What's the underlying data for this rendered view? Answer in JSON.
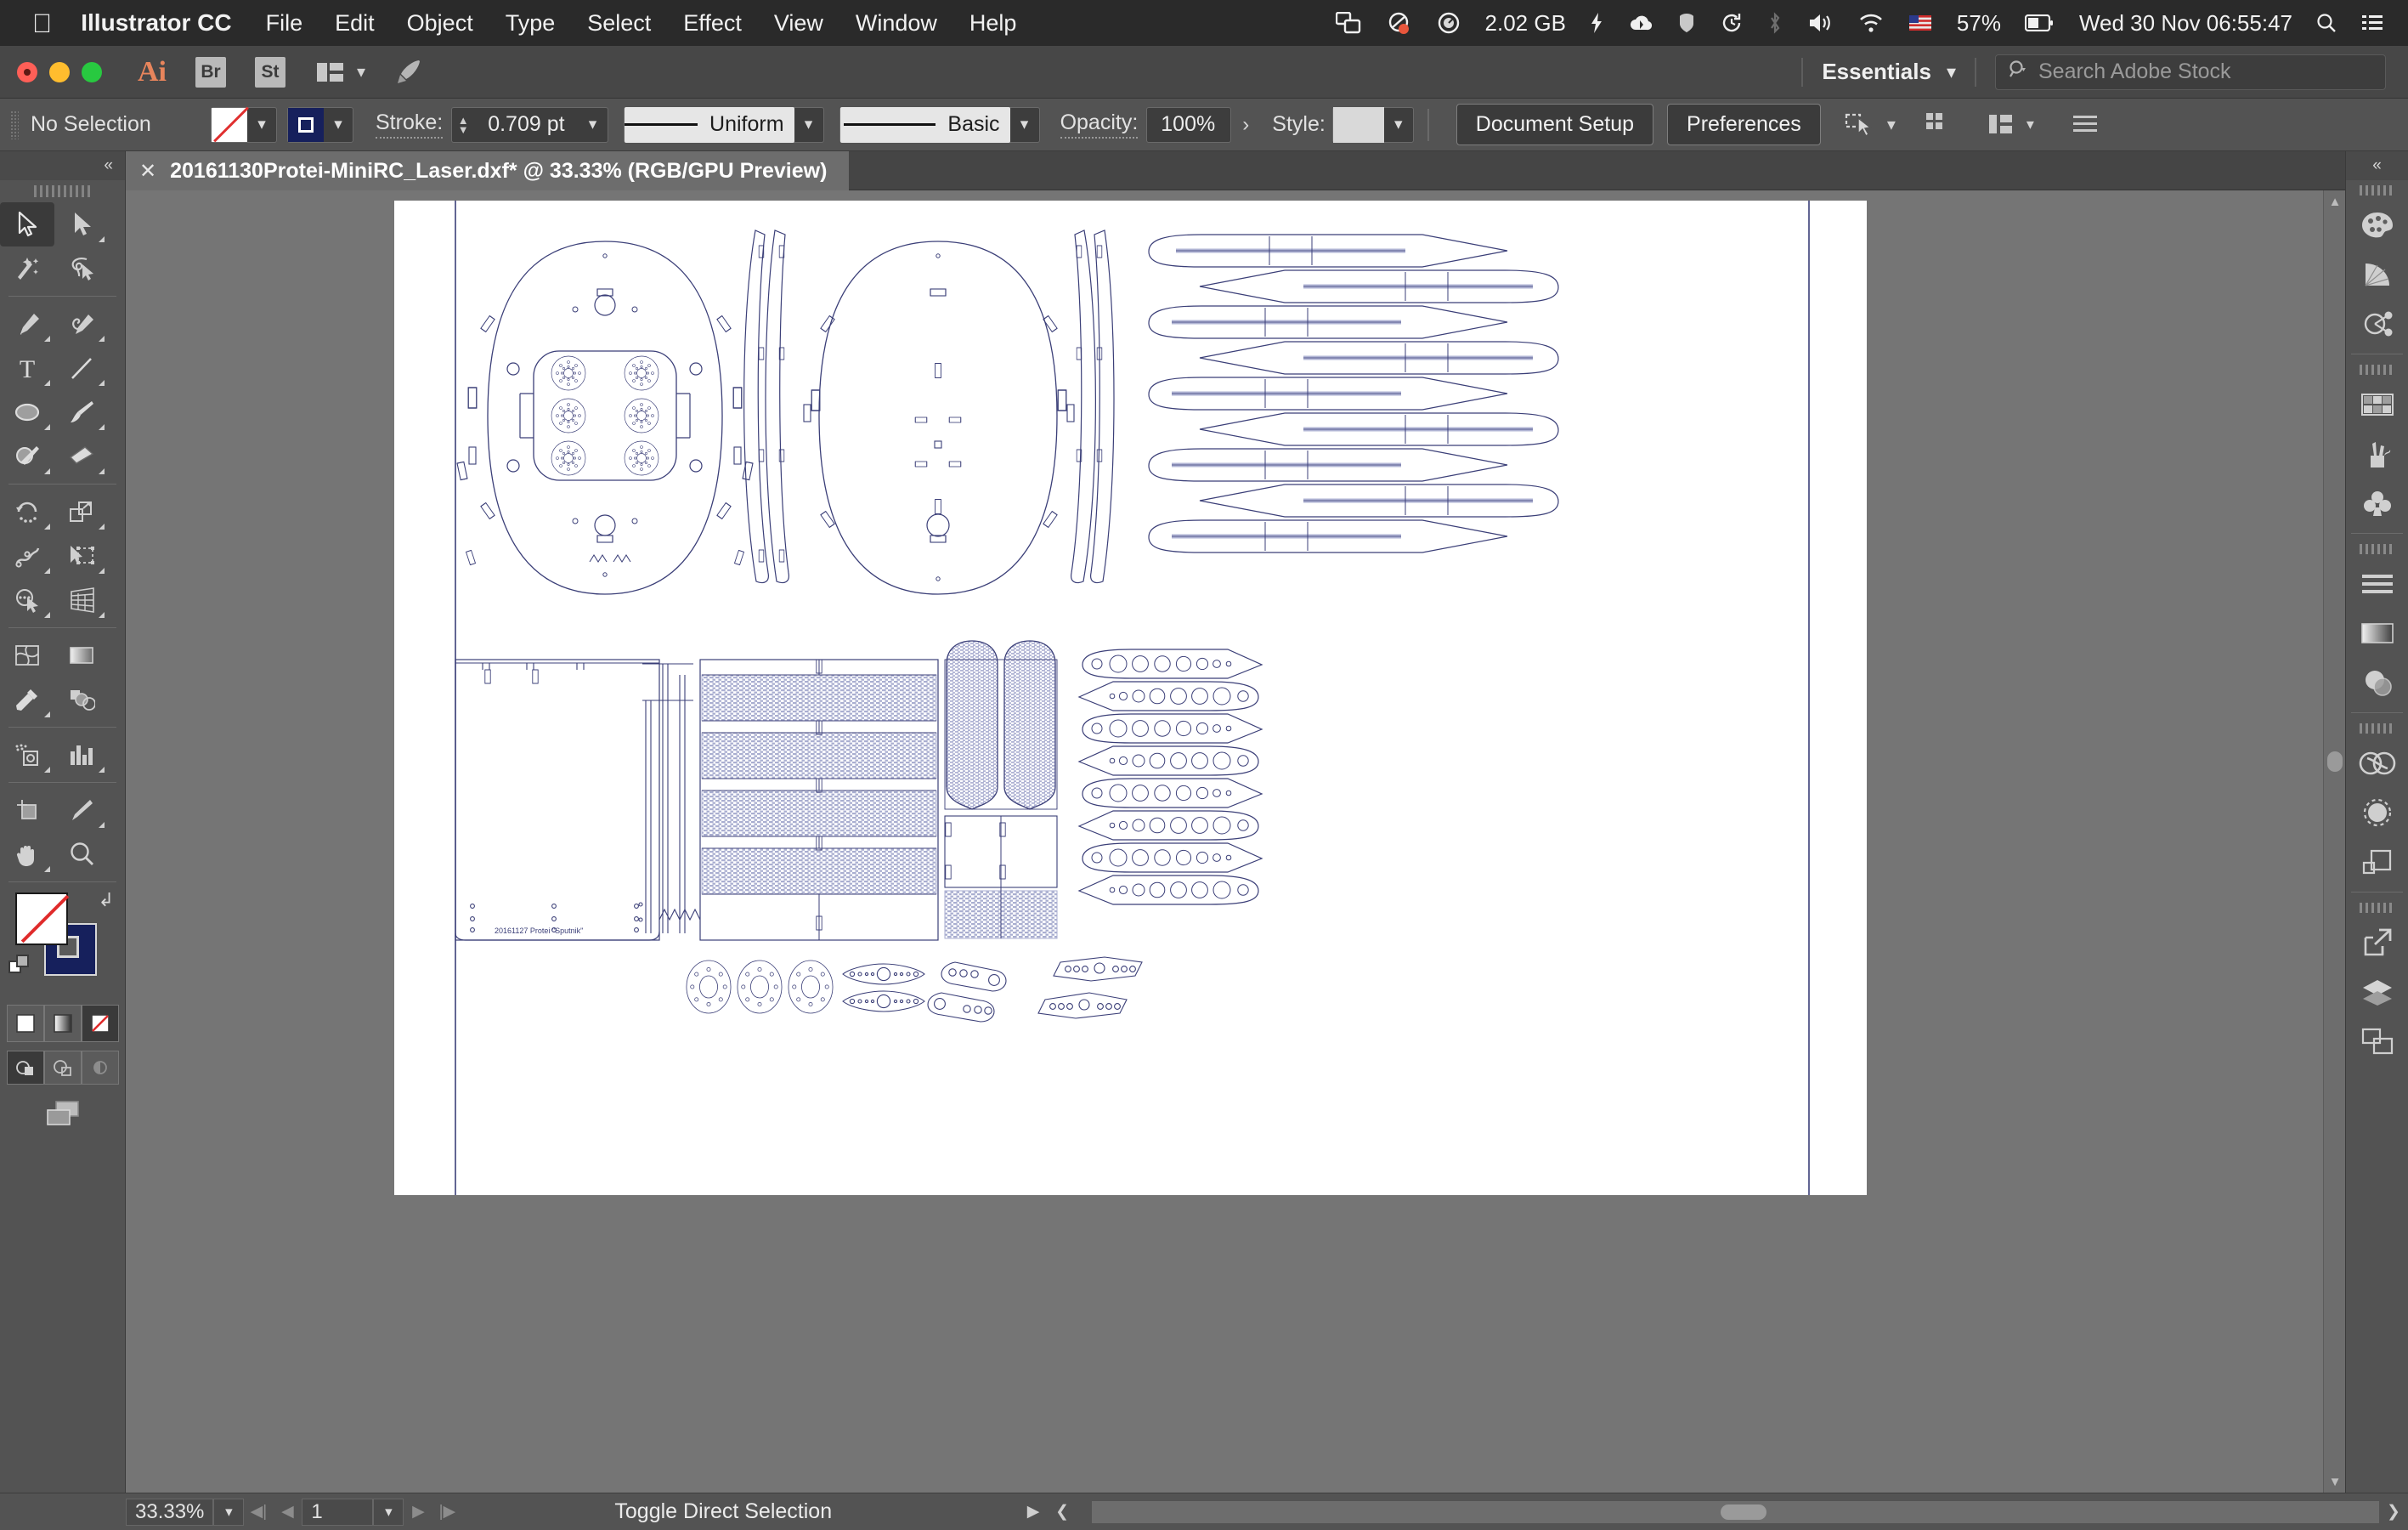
{
  "macmenu": {
    "apple_icon": "apple-icon",
    "app": "Illustrator CC",
    "items": [
      "File",
      "Edit",
      "Object",
      "Type",
      "Select",
      "Effect",
      "View",
      "Window",
      "Help"
    ],
    "status": {
      "memory": "2.02 GB",
      "battery_percent": "57%",
      "datetime": "Wed 30 Nov  06:55:47",
      "icons": [
        "screen-share-icon",
        "dropbox-sync-icon",
        "memory-gauge-icon",
        "bolt-icon",
        "cloud-icon",
        "shield-icon",
        "time-machine-icon",
        "bluetooth-icon",
        "volume-icon",
        "wifi-icon",
        "flag-us-icon",
        "battery-icon",
        "spotlight-search-icon",
        "notification-center-icon"
      ]
    }
  },
  "appbar": {
    "logo": "Ai",
    "bridge_label": "Br",
    "stock_label": "St",
    "arrange_icon": "arrange-documents-icon",
    "rocket_icon": "rocket-icon",
    "workspace": "Essentials",
    "workspace_caret": "chevron-down-icon",
    "search_placeholder": "Search Adobe Stock",
    "search_icon": "search-icon"
  },
  "control_bar": {
    "selection_status": "No Selection",
    "fill_swatch": "none-fill",
    "stroke_swatch": "stroke-color-navy",
    "stroke_label": "Stroke:",
    "stroke_weight": "0.709 pt",
    "stroke_profile": "Uniform",
    "brush_definition": "Basic",
    "opacity_label": "Opacity:",
    "opacity_value": "100%",
    "style_label": "Style:",
    "document_setup": "Document Setup",
    "preferences": "Preferences",
    "align_icon": "align-to-selection-icon"
  },
  "document_tab": {
    "close_icon": "close-icon",
    "title": "20161130Protei-MiniRC_Laser.dxf* @ 33.33% (RGB/GPU Preview)"
  },
  "tools": {
    "collapse_icon": "collapse-panel-icon",
    "items": [
      {
        "name": "selection-tool",
        "active": true
      },
      {
        "name": "direct-selection-tool",
        "active": false
      },
      {
        "name": "magic-wand-tool",
        "active": false
      },
      {
        "name": "lasso-tool",
        "active": false
      },
      {
        "name": "pen-tool",
        "active": false
      },
      {
        "name": "curvature-tool",
        "active": false
      },
      {
        "name": "type-tool",
        "active": false
      },
      {
        "name": "line-segment-tool",
        "active": false
      },
      {
        "name": "ellipse-tool",
        "active": false
      },
      {
        "name": "paintbrush-tool",
        "active": false
      },
      {
        "name": "shaper-tool",
        "active": false
      },
      {
        "name": "eraser-tool",
        "active": false
      },
      {
        "name": "rotate-tool",
        "active": false
      },
      {
        "name": "scale-tool",
        "active": false
      },
      {
        "name": "width-tool",
        "active": false
      },
      {
        "name": "free-transform-tool",
        "active": false
      },
      {
        "name": "shape-builder-tool",
        "active": false
      },
      {
        "name": "perspective-grid-tool",
        "active": false
      },
      {
        "name": "mesh-tool",
        "active": false
      },
      {
        "name": "gradient-tool",
        "active": false
      },
      {
        "name": "eyedropper-tool",
        "active": false
      },
      {
        "name": "blend-tool",
        "active": false
      },
      {
        "name": "symbol-sprayer-tool",
        "active": false
      },
      {
        "name": "column-graph-tool",
        "active": false
      },
      {
        "name": "artboard-tool",
        "active": false
      },
      {
        "name": "slice-tool",
        "active": false
      },
      {
        "name": "hand-tool",
        "active": false
      },
      {
        "name": "zoom-tool",
        "active": false
      }
    ],
    "fill_color": "#ffffff",
    "fill_is_none": true,
    "stroke_color": "#16205c",
    "swap_icon": "swap-fill-stroke-icon",
    "default_icon": "default-fill-stroke-icon",
    "color_modes": [
      "color-swatch-mode",
      "gradient-mode",
      "none-mode"
    ],
    "color_mode_selected": 2,
    "draw_modes": [
      "draw-normal-mode",
      "draw-behind-mode",
      "draw-inside-mode"
    ],
    "draw_mode_selected": 0,
    "screen_mode_icon": "change-screen-mode-icon"
  },
  "right_dock": {
    "collapse_icon": "expand-panels-icon",
    "groups": [
      [
        "color-panel-icon",
        "color-guide-panel-icon",
        "symbols-panel-icon"
      ],
      [
        "swatches-panel-icon",
        "brushes-panel-icon",
        "symbols-library-icon"
      ],
      [
        "align-panel-icon",
        "gradient-panel-icon",
        "transparency-panel-icon"
      ],
      [
        "creative-cloud-libraries-icon",
        "appearance-panel-icon",
        "pathfinder-panel-icon"
      ],
      [
        "links-panel-icon",
        "layers-panel-icon",
        "artboards-panel-icon"
      ]
    ]
  },
  "status_bar": {
    "zoom_level": "33.33%",
    "zoom_caret": "chevron-down-icon",
    "first_artboard_icon": "first-artboard-icon",
    "prev_artboard_icon": "previous-artboard-icon",
    "artboard_number": "1",
    "artboard_caret": "chevron-down-icon",
    "next_artboard_icon": "next-artboard-icon",
    "last_artboard_icon": "last-artboard-icon",
    "status_text": "Toggle Direct Selection",
    "status_caret": "status-menu-icon"
  },
  "artwork": {
    "label_text": "20161127 Protei \"Sputnik\"",
    "stroke_color": "#3b3f78",
    "hatch_color": "#a9aed0",
    "description": "laser-cut DXF nesting layout for Protei MiniRC model: two hull deck ovals, stacked airfoil wing ribs, hatched panel sheets, hull keel strips, circular gear plates and servo horn arms"
  }
}
